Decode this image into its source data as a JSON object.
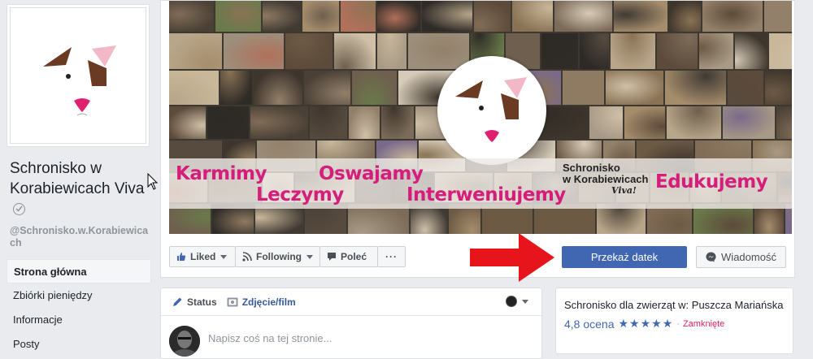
{
  "page": {
    "name": "Schronisko w Korabiewicach Viva",
    "handle": "@Schronisko.w.Korabiewicach"
  },
  "left_nav": {
    "items": [
      "Strona główna",
      "Zbiórki pieniędzy",
      "Informacje",
      "Posty"
    ],
    "active_index": 0
  },
  "cover": {
    "slogans": [
      "Karmimy",
      "Leczymy",
      "Oswajamy",
      "Interweniujemy",
      "Edukujemy"
    ],
    "brand_line1": "Schronisko",
    "brand_line2": "w Korabiewicach",
    "brand_line3": "Viva!"
  },
  "actions": {
    "liked": "Liked",
    "following": "Following",
    "recommend": "Poleć",
    "more": "···",
    "donate": "Przekaż datek",
    "message": "Wiadomość"
  },
  "composer": {
    "tab_status": "Status",
    "tab_photo": "Zdjęcie/film",
    "placeholder": "Napisz coś na tej stronie..."
  },
  "info": {
    "category": "Schronisko dla zwierząt w: Puszcza Mariańska",
    "rating": "4,8 ocena",
    "stars": "★★★★★",
    "separator": "·",
    "status": "Zamknięte"
  },
  "colors": {
    "brand_blue": "#4267b2",
    "link_blue": "#365899",
    "slogan_pink": "#d41e7a",
    "arrow_red": "#e8141b",
    "closed_red": "#e0245e"
  }
}
